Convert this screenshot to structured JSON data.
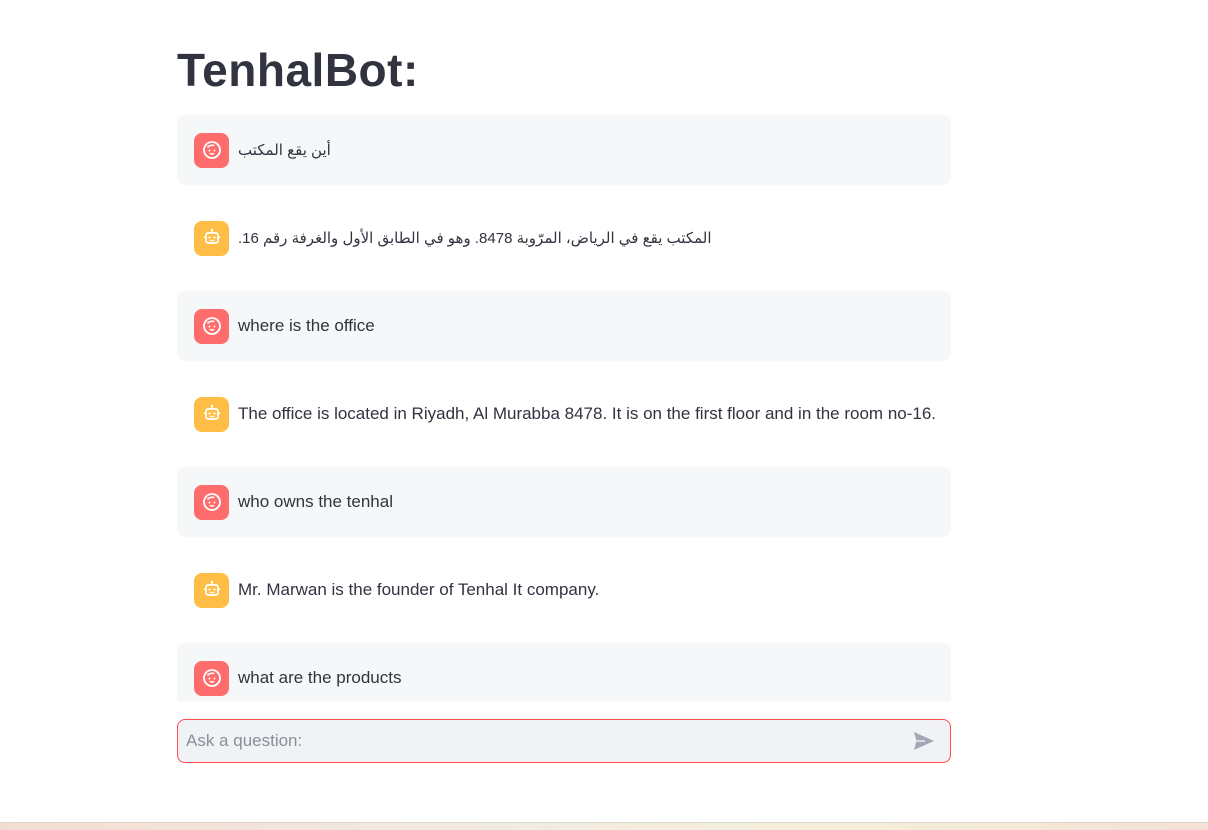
{
  "page": {
    "title": "TenhalBot:"
  },
  "messages": [
    {
      "role": "user",
      "text": "أين يقع المكتب",
      "avatar_icon": "user-face-icon"
    },
    {
      "role": "bot",
      "text": "المكتب يقع في الرياض، المرّوبة 8478. وهو في الطابق الأول والغرفة رقم 16.",
      "avatar_icon": "robot-icon"
    },
    {
      "role": "user",
      "text": "where is the office",
      "avatar_icon": "user-face-icon"
    },
    {
      "role": "bot",
      "text": "The office is located in Riyadh, Al Murabba 8478. It is on the first floor and in the room no-16.",
      "avatar_icon": "robot-icon"
    },
    {
      "role": "user",
      "text": "who owns the tenhal",
      "avatar_icon": "user-face-icon"
    },
    {
      "role": "bot",
      "text": "Mr. Marwan is the founder of Tenhal It company.",
      "avatar_icon": "robot-icon"
    },
    {
      "role": "user",
      "text": "what are the products",
      "avatar_icon": "user-face-icon"
    }
  ],
  "input": {
    "placeholder": "Ask a question:",
    "value": "",
    "send_icon": "send-icon"
  },
  "colors": {
    "user_avatar": "#ff6c6c",
    "bot_avatar": "#ffbd45",
    "user_bubble": "#f6f7f9",
    "input_border": "#ff4b4b",
    "input_bg": "#f0f2f6"
  }
}
